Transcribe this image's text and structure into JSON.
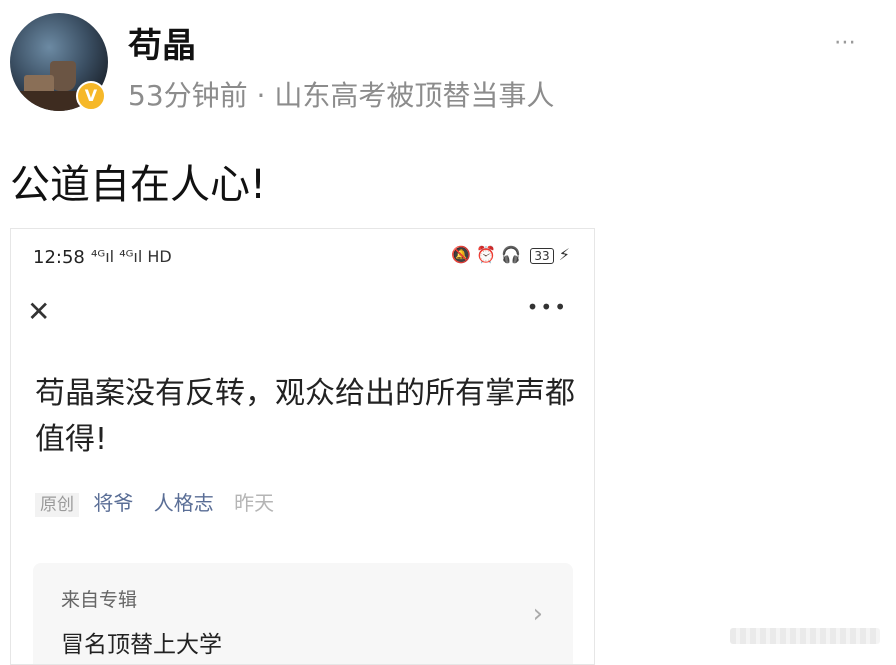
{
  "post": {
    "username": "苟晶",
    "time": "53分钟前",
    "separator": "·",
    "source_desc": "山东高考被顶替当事人",
    "verified_badge": "V",
    "more_icon": "⋯",
    "text": "公道自在人心!"
  },
  "screenshot": {
    "status_time": "12:58",
    "status_network": "⁴ᴳıl ⁴ᴳıl HD",
    "battery": "33",
    "close_icon": "✕",
    "more_icon": "•••",
    "title": "苟晶案没有反转，观众给出的所有掌声都值得!",
    "tag_original": "原创",
    "author1": "将爷",
    "author2": "人格志",
    "date": "昨天",
    "album_label": "来自专辑",
    "album_title": "冒名顶替上大学",
    "album_chevron": "›"
  }
}
